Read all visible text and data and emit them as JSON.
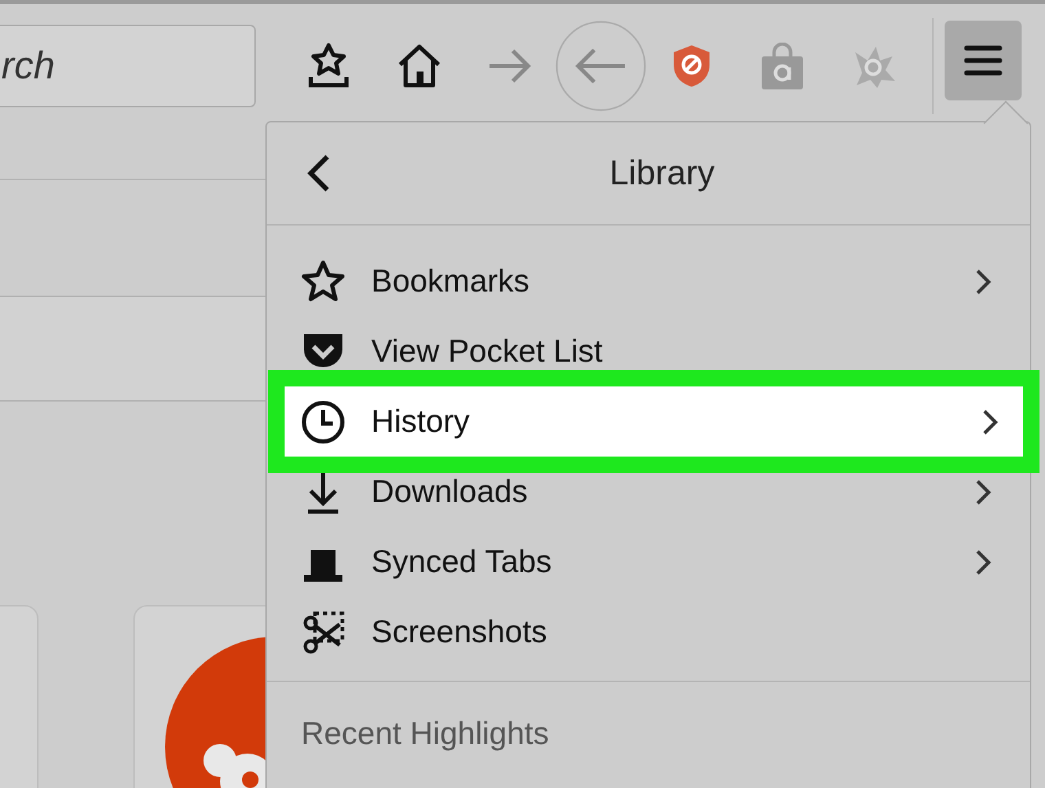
{
  "toolbar": {
    "search": {
      "placeholder": "rch"
    }
  },
  "library_panel": {
    "title": "Library",
    "items": [
      {
        "label": "Bookmarks",
        "kind": "star",
        "submenu": true,
        "selected": false
      },
      {
        "label": "View Pocket List",
        "kind": "pocket",
        "submenu": false,
        "selected": false
      },
      {
        "label": "History",
        "kind": "clock",
        "submenu": true,
        "selected": true
      },
      {
        "label": "Downloads",
        "kind": "download",
        "submenu": true,
        "selected": false
      },
      {
        "label": "Synced Tabs",
        "kind": "synced",
        "submenu": true,
        "selected": false
      },
      {
        "label": "Screenshots",
        "kind": "scissors",
        "submenu": false,
        "selected": false
      }
    ],
    "section": "Recent Highlights"
  }
}
